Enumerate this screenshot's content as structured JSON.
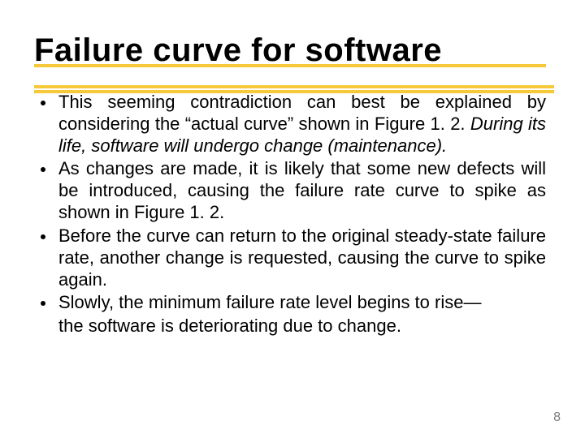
{
  "title": "Failure curve for software",
  "bullets": [
    {
      "pre": "This seeming contradiction can best be explained by considering the “actual curve” shown in Figure 1. 2. ",
      "italic": "During its life, software will undergo change (maintenance).",
      "post": ""
    },
    {
      "pre": "As changes are made, it is likely that some new defects will be introduced, causing the failure rate curve to spike as shown in Figure 1. 2.",
      "italic": "",
      "post": ""
    },
    {
      "pre": " Before the curve can return to the original steady-state failure rate, another change is requested, causing the curve to spike again.",
      "italic": "",
      "post": ""
    },
    {
      "pre": "Slowly, the minimum failure rate level begins to rise—",
      "italic": "",
      "post": ""
    }
  ],
  "trailing": "the software is deteriorating due to change.",
  "page_number": "8"
}
